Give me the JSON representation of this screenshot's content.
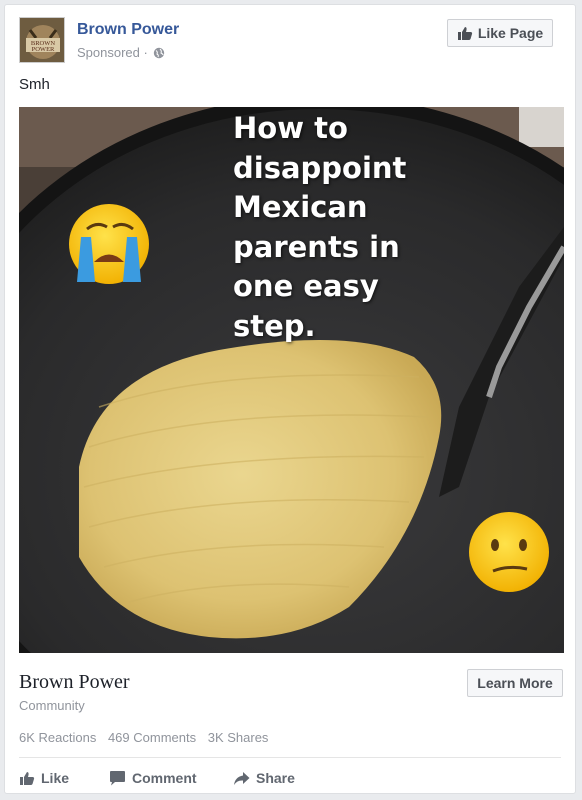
{
  "post": {
    "page_name": "Brown Power",
    "sponsored": "Sponsored ·",
    "like_page_label": "Like Page",
    "caption": "Smh",
    "avatar_text_line1": "BROWN",
    "avatar_text_line2": "POWER"
  },
  "image": {
    "headline": "How to\ndisappoint\nMexican\nparents in\none easy\nstep."
  },
  "link": {
    "title": "Brown Power",
    "subtitle": "Community",
    "learn_more_label": "Learn More"
  },
  "stats": {
    "reactions": "6K Reactions",
    "comments": "469 Comments",
    "shares": "3K Shares"
  },
  "actions": {
    "like": "Like",
    "comment": "Comment",
    "share": "Share"
  },
  "colors": {
    "link_blue": "#365899",
    "gray_text": "#90949c",
    "action_gray": "#616770"
  },
  "icons": [
    "globe-icon",
    "thumbs-up-icon",
    "comment-icon",
    "share-icon",
    "crying-emoji-icon",
    "confused-emoji-icon"
  ]
}
